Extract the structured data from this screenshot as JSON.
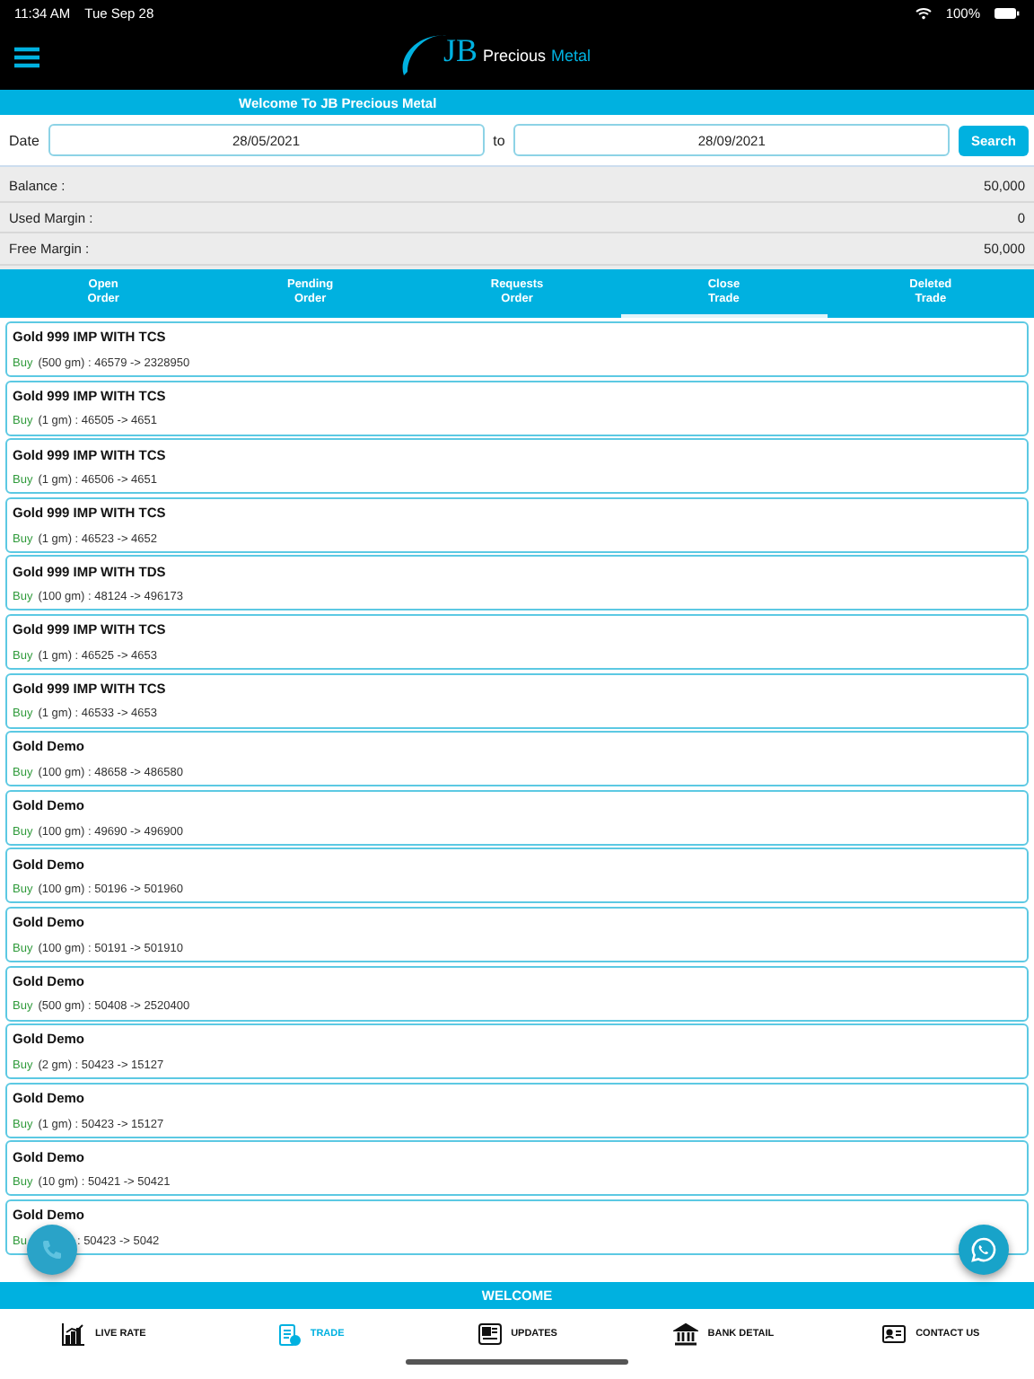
{
  "status_bar": {
    "time": "11:34 AM",
    "date": "Tue Sep 28",
    "battery": "100%"
  },
  "header": {
    "logo_initials": "JB",
    "logo_word1": "Precious",
    "logo_word2": "Metal"
  },
  "welcome_banner": "Welcome To JB Precious Metal",
  "date_filter": {
    "label": "Date",
    "from": "28/05/2021",
    "separator": "to",
    "to": "28/09/2021",
    "button": "Search"
  },
  "summary": [
    {
      "label": "Balance :",
      "value": "50,000"
    },
    {
      "label": "Used Margin :",
      "value": "0"
    },
    {
      "label": "Free Margin :",
      "value": "50,000"
    }
  ],
  "tabs": [
    {
      "label": "Open\nOrder",
      "selected": false
    },
    {
      "label": "Pending\nOrder",
      "selected": false
    },
    {
      "label": "Requests\nOrder",
      "selected": false
    },
    {
      "label": "Close\nTrade",
      "selected": true
    },
    {
      "label": "Deleted\nTrade",
      "selected": false
    }
  ],
  "trades": [
    {
      "title": "Gold 999 IMP WITH TCS",
      "side": "Buy",
      "detail": "(500 gm) : 46579 -> 2328950"
    },
    {
      "title": "Gold 999 IMP WITH TCS",
      "side": "Buy",
      "detail": "(1 gm) : 46505 -> 4651"
    },
    {
      "title": "Gold 999 IMP WITH TCS",
      "side": "Buy",
      "detail": "(1 gm) : 46506 -> 4651"
    },
    {
      "title": "Gold 999 IMP WITH TCS",
      "side": "Buy",
      "detail": "(1 gm) : 46523 -> 4652"
    },
    {
      "title": "Gold 999 IMP WITH TDS",
      "side": "Buy",
      "detail": "(100 gm) : 48124 -> 496173"
    },
    {
      "title": "Gold 999 IMP WITH TCS",
      "side": "Buy",
      "detail": "(1 gm) : 46525 -> 4653"
    },
    {
      "title": "Gold 999 IMP WITH TCS",
      "side": "Buy",
      "detail": "(1 gm) : 46533 -> 4653"
    },
    {
      "title": "Gold Demo",
      "side": "Buy",
      "detail": "(100 gm) : 48658 -> 486580"
    },
    {
      "title": "Gold Demo",
      "side": "Buy",
      "detail": "(100 gm) : 49690 -> 496900"
    },
    {
      "title": "Gold Demo",
      "side": "Buy",
      "detail": "(100 gm) : 50196 -> 501960"
    },
    {
      "title": "Gold Demo",
      "side": "Buy",
      "detail": "(100 gm) : 50191 -> 501910"
    },
    {
      "title": "Gold Demo",
      "side": "Buy",
      "detail": "(500 gm) : 50408 -> 2520400"
    },
    {
      "title": "Gold Demo",
      "side": "Buy",
      "detail": "(2 gm) : 50423 -> 15127"
    },
    {
      "title": "Gold Demo",
      "side": "Buy",
      "detail": "(1 gm) : 50423 -> 15127"
    },
    {
      "title": "Gold Demo",
      "side": "Buy",
      "detail": "(10 gm) : 50421 -> 50421"
    },
    {
      "title": "Gold Demo",
      "side": "Bu",
      "detail": ": 50423 -> 5042",
      "covered": true
    }
  ],
  "footer_banner": "WELCOME",
  "bottom_nav": [
    {
      "label": "LIVE RATE",
      "selected": false
    },
    {
      "label": "TRADE",
      "selected": true
    },
    {
      "label": "UPDATES",
      "selected": false
    },
    {
      "label": "BANK DETAIL",
      "selected": false
    },
    {
      "label": "CONTACT US",
      "selected": false
    }
  ]
}
